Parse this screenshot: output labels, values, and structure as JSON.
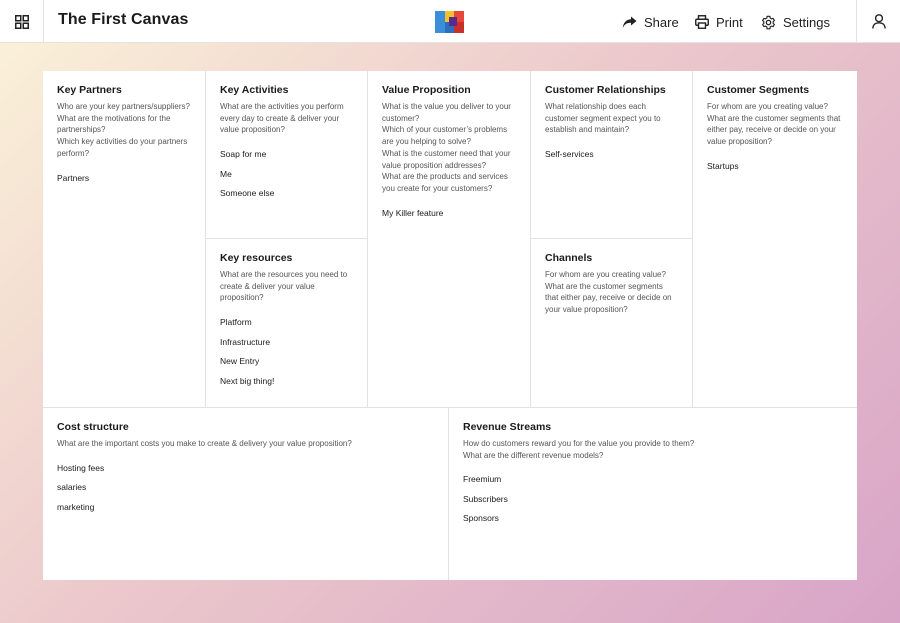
{
  "header": {
    "title": "The First Canvas",
    "share_label": "Share",
    "print_label": "Print",
    "settings_label": "Settings",
    "icons": {
      "menu": "grid-icon",
      "share": "share-arrow-icon",
      "print": "printer-icon",
      "settings": "gear-icon",
      "user": "user-icon",
      "logo": "app-logo"
    },
    "logo_colors": [
      "#3a8fd8",
      "#e8473b",
      "#f3c12e",
      "#5a2a8a",
      "#2b6fc0",
      "#c8302b"
    ]
  },
  "canvas": {
    "partners": {
      "title": "Key Partners",
      "questions": [
        "Who are your key partners/suppliers?",
        "What are the motivations for the partnerships?",
        "Which key activities do your partners perform?"
      ],
      "entries": [
        "Partners"
      ]
    },
    "activities": {
      "title": "Key Activities",
      "questions": [
        "What are the activities you perform every day to create & deliver your value proposition?"
      ],
      "entries": [
        "Soap for me",
        "Me",
        "Someone else"
      ]
    },
    "resources": {
      "title": "Key resources",
      "questions": [
        "What are the resources you need to create & deliver your value proposition?"
      ],
      "entries": [
        "Platform",
        "Infrastructure",
        "New Entry",
        "Next big thing!"
      ]
    },
    "value": {
      "title": "Value Proposition",
      "questions": [
        "What is the value you deliver to your customer?",
        "Which of your customer’s problems are you helping to solve?",
        "What is the customer need that your value proposition addresses?",
        "What are the products and services you create for your customers?"
      ],
      "entries": [
        "My Killer feature"
      ]
    },
    "relationships": {
      "title": "Customer Relationships",
      "questions": [
        "What relationship does each customer segment expect you to establish and maintain?"
      ],
      "entries": [
        "Self-services"
      ]
    },
    "channels": {
      "title": "Channels",
      "questions": [
        "For whom are you creating value?",
        "What are the customer segments that either pay, receive or decide on your value proposition?"
      ],
      "entries": []
    },
    "segments": {
      "title": "Customer Segments",
      "questions": [
        "For whom are you creating value?",
        "What are the customer segments that either pay, receive or decide on your value proposition?"
      ],
      "entries": [
        "Startups"
      ]
    },
    "cost": {
      "title": "Cost structure",
      "questions": [
        "What are the important costs you make to create & delivery your value proposition?"
      ],
      "entries": [
        "Hosting fees",
        "salaries",
        "marketing"
      ]
    },
    "revenue": {
      "title": "Revenue Streams",
      "questions": [
        "How do customers reward you for the value you provide to them?",
        "What are the different revenue models?"
      ],
      "entries": [
        "Freemium",
        "Subscribers",
        "Sponsors"
      ]
    }
  }
}
